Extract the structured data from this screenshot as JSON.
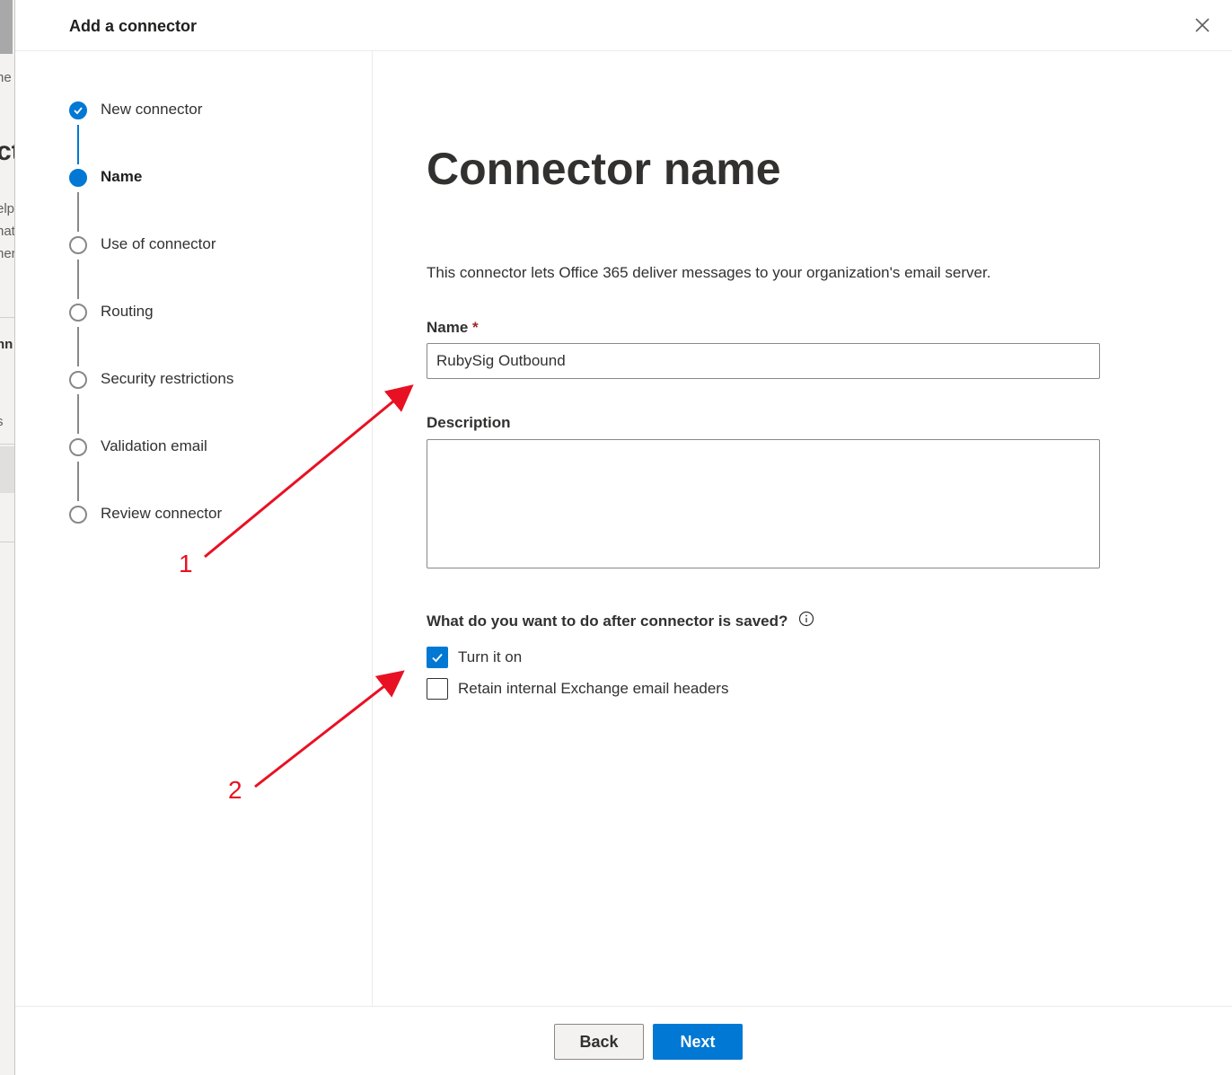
{
  "background": {
    "fragments": [
      "ne",
      "ct",
      "elp",
      "nat",
      "her",
      "nn",
      "s"
    ]
  },
  "panel": {
    "title": "Add a connector",
    "close_icon": "close-icon"
  },
  "steps": [
    {
      "label": "New connector",
      "state": "done"
    },
    {
      "label": "Name",
      "state": "current"
    },
    {
      "label": "Use of connector",
      "state": "pending"
    },
    {
      "label": "Routing",
      "state": "pending"
    },
    {
      "label": "Security restrictions",
      "state": "pending"
    },
    {
      "label": "Validation email",
      "state": "pending"
    },
    {
      "label": "Review connector",
      "state": "pending"
    }
  ],
  "content": {
    "heading": "Connector name",
    "intro": "This connector lets Office 365 deliver messages to your organization's email server.",
    "name_label": "Name",
    "name_required": "*",
    "name_value": "RubySig Outbound",
    "description_label": "Description",
    "description_value": "",
    "question": "What do you want to do after connector is saved?",
    "options": [
      {
        "label": "Turn it on",
        "checked": true
      },
      {
        "label": "Retain internal Exchange email headers",
        "checked": false
      }
    ]
  },
  "footer": {
    "back_label": "Back",
    "next_label": "Next"
  },
  "annotations": {
    "color": "#e81123",
    "labels": [
      "1",
      "2"
    ]
  },
  "colors": {
    "accent": "#0078d4",
    "required": "#a4262c"
  }
}
